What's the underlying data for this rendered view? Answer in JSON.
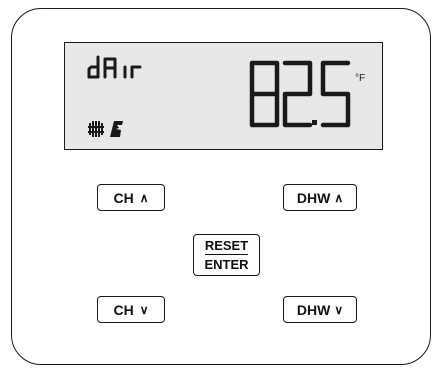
{
  "display": {
    "mode_text": "dA ir",
    "temperature": "82.5",
    "unit": "°F",
    "icons": [
      "radiator-icon",
      "flame-icon"
    ],
    "background_color": "#e7e8e9"
  },
  "buttons": {
    "ch_up": {
      "label": "CH",
      "arrow": "∧"
    },
    "dhw_up": {
      "label": "DHW",
      "arrow": "∧"
    },
    "reset_enter": {
      "top": "RESET",
      "bottom": "ENTER"
    },
    "ch_down": {
      "label": "CH",
      "arrow": "∨"
    },
    "dhw_down": {
      "label": "DHW",
      "arrow": "∨"
    }
  }
}
